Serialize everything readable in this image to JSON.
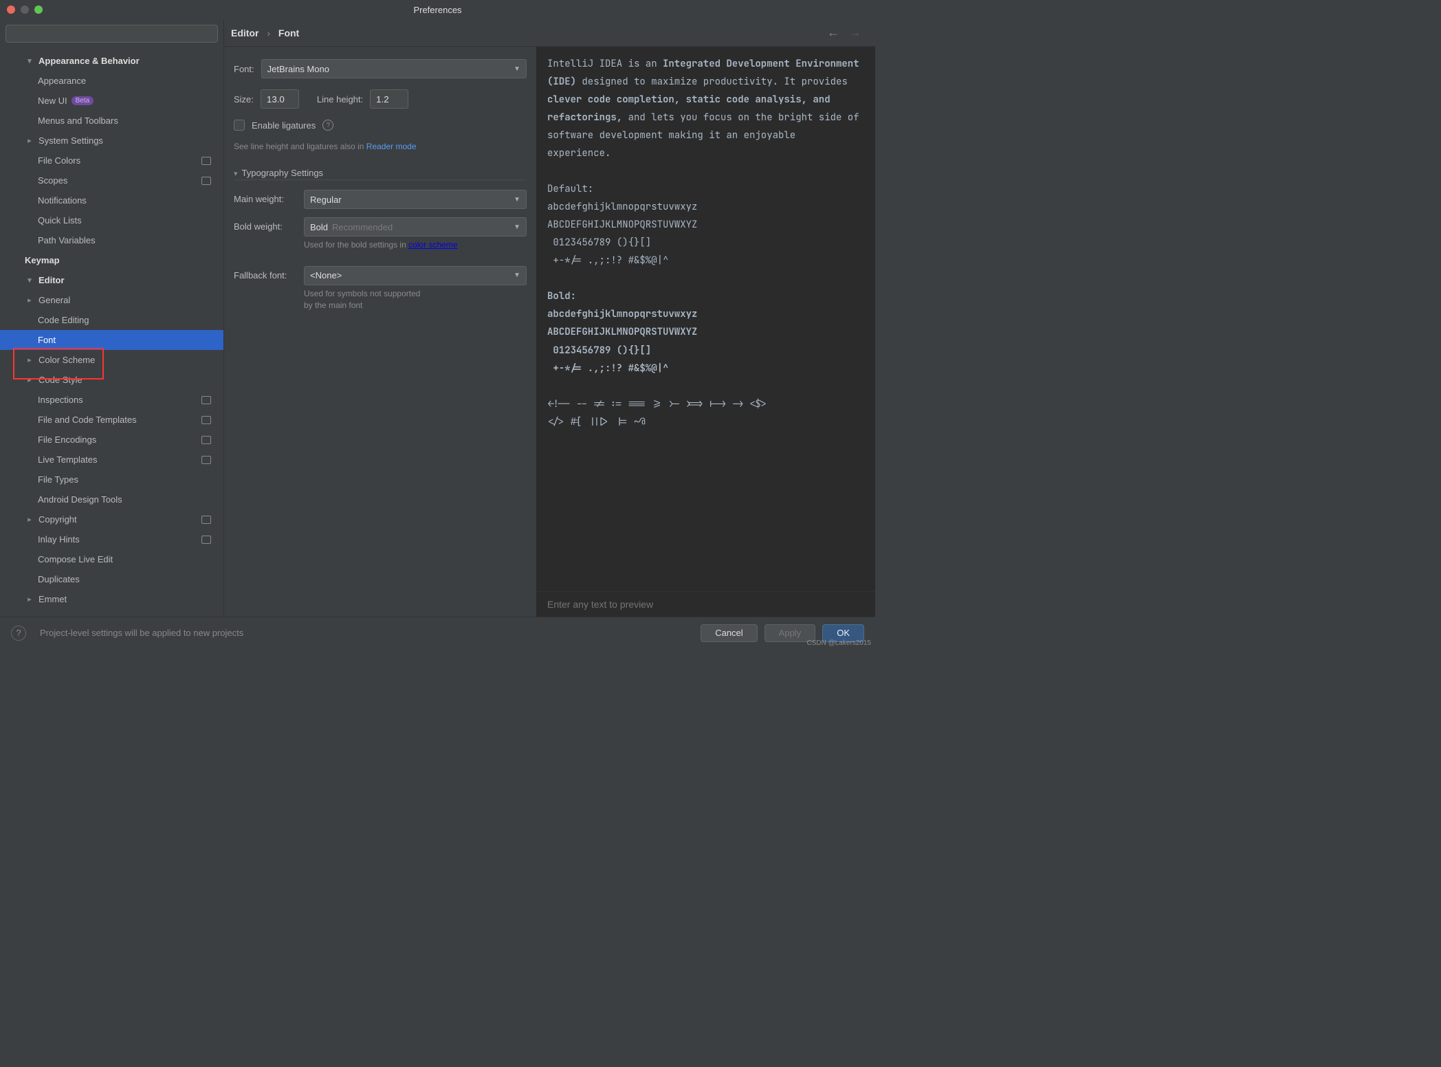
{
  "window": {
    "title": "Preferences"
  },
  "search": {
    "placeholder": ""
  },
  "sidebar": {
    "items": [
      {
        "label": "Appearance & Behavior",
        "kind": "top",
        "chev": "down"
      },
      {
        "label": "Appearance",
        "kind": "sub1"
      },
      {
        "label": "New UI",
        "kind": "sub1",
        "badge": "Beta"
      },
      {
        "label": "Menus and Toolbars",
        "kind": "sub1"
      },
      {
        "label": "System Settings",
        "kind": "sub2",
        "chev": "right"
      },
      {
        "label": "File Colors",
        "kind": "sub1",
        "tag": true
      },
      {
        "label": "Scopes",
        "kind": "sub1",
        "tag": true
      },
      {
        "label": "Notifications",
        "kind": "sub1"
      },
      {
        "label": "Quick Lists",
        "kind": "sub1"
      },
      {
        "label": "Path Variables",
        "kind": "sub1"
      },
      {
        "label": "Keymap",
        "kind": "top",
        "bold": true
      },
      {
        "label": "Editor",
        "kind": "top",
        "chev": "down"
      },
      {
        "label": "General",
        "kind": "sub2",
        "chev": "right"
      },
      {
        "label": "Code Editing",
        "kind": "sub1"
      },
      {
        "label": "Font",
        "kind": "sub1",
        "selected": true
      },
      {
        "label": "Color Scheme",
        "kind": "sub2",
        "chev": "right"
      },
      {
        "label": "Code Style",
        "kind": "sub2",
        "chev": "right"
      },
      {
        "label": "Inspections",
        "kind": "sub1",
        "tag": true
      },
      {
        "label": "File and Code Templates",
        "kind": "sub1",
        "tag": true
      },
      {
        "label": "File Encodings",
        "kind": "sub1",
        "tag": true
      },
      {
        "label": "Live Templates",
        "kind": "sub1",
        "tag": true
      },
      {
        "label": "File Types",
        "kind": "sub1"
      },
      {
        "label": "Android Design Tools",
        "kind": "sub1"
      },
      {
        "label": "Copyright",
        "kind": "sub2",
        "chev": "right",
        "tag": true
      },
      {
        "label": "Inlay Hints",
        "kind": "sub1",
        "tag": true
      },
      {
        "label": "Compose Live Edit",
        "kind": "sub1"
      },
      {
        "label": "Duplicates",
        "kind": "sub1"
      },
      {
        "label": "Emmet",
        "kind": "sub2",
        "chev": "right"
      }
    ]
  },
  "breadcrumb": {
    "parent": "Editor",
    "current": "Font"
  },
  "form": {
    "font_label": "Font:",
    "font_value": "JetBrains Mono",
    "size_label": "Size:",
    "size_value": "13.0",
    "line_height_label": "Line height:",
    "line_height_value": "1.2",
    "ligatures_label": "Enable ligatures",
    "reader_hint_pre": "See line height and ligatures also in ",
    "reader_hint_link": "Reader mode",
    "typography_header": "Typography Settings",
    "main_weight_label": "Main weight:",
    "main_weight_value": "Regular",
    "bold_weight_label": "Bold weight:",
    "bold_weight_value": "Bold",
    "bold_weight_rec": "Recommended",
    "bold_hint_pre": "Used for the bold settings in ",
    "bold_hint_link": "color scheme",
    "fallback_label": "Fallback font:",
    "fallback_value": "<None>",
    "fallback_hint_1": "Used for symbols not supported",
    "fallback_hint_2": "by the main font"
  },
  "preview": {
    "placeholder": "Enter any text to preview",
    "p1_a": "IntelliJ IDEA is an ",
    "p1_b": "Integrated Development Environment (IDE)",
    "p1_c": " designed to maximize productivity. It provides ",
    "p1_d": "clever code completion, static code analysis, and refactorings,",
    "p1_e": " and lets you focus on the bright side of software development making it an enjoyable experience.",
    "default_label": "Default:",
    "sample_lower": "abcdefghijklmnopqrstuvwxyz",
    "sample_upper": "ABCDEFGHIJKLMNOPQRSTUVWXYZ",
    "sample_digits": " 0123456789 (){}[]",
    "sample_symbols": " +-*/= .,;:!? #&$%@|^",
    "bold_label": "Bold:",
    "ligatures_1": "<!-- -- != := === >= >- >=> |-> -> <$>",
    "ligatures_2": "</> #[ |||> |= ~@"
  },
  "footer": {
    "hint": "Project-level settings will be applied to new projects",
    "cancel": "Cancel",
    "apply": "Apply",
    "ok": "OK"
  },
  "watermark": "CSDN @Lakers2015"
}
